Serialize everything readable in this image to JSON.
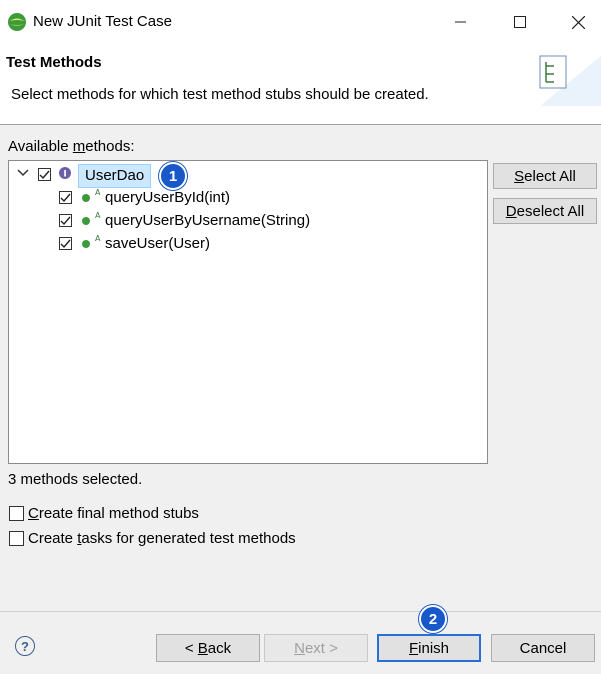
{
  "window": {
    "title": "New JUnit Test Case",
    "controls": [
      "minimize",
      "maximize",
      "close"
    ]
  },
  "header": {
    "title": "Test Methods",
    "description": "Select methods for which test method stubs should be created."
  },
  "available_methods_label": {
    "pre": "Available ",
    "mnemonic": "m",
    "post": "ethods:"
  },
  "tree": {
    "root": {
      "label": "UserDao",
      "checked": true,
      "expanded": true,
      "icon": "interface-icon"
    },
    "children": [
      {
        "label": "queryUserById(int)",
        "checked": true,
        "icon": "abstract-method-icon"
      },
      {
        "label": "queryUserByUsername(String)",
        "checked": true,
        "icon": "abstract-method-icon"
      },
      {
        "label": "saveUser(User)",
        "checked": true,
        "icon": "abstract-method-icon"
      }
    ]
  },
  "side_buttons": {
    "select_all": {
      "mnemonic": "S",
      "rest": "elect All"
    },
    "deselect_all": {
      "mnemonic": "D",
      "rest": "eselect All"
    }
  },
  "status_text": "3 methods selected.",
  "options": {
    "final_stubs": {
      "mnemonic": "C",
      "rest": "reate final method stubs",
      "checked": false
    },
    "tasks": {
      "pre": "Create ",
      "mnemonic": "t",
      "rest": "asks for generated test methods",
      "checked": false
    }
  },
  "badges": {
    "one": "1",
    "two": "2"
  },
  "footer": {
    "help": "?",
    "back": {
      "pre": "< ",
      "mnemonic": "B",
      "rest": "ack"
    },
    "next": {
      "mnemonic": "N",
      "rest": "ext >"
    },
    "finish": {
      "mnemonic": "F",
      "rest": "inish"
    },
    "cancel": "Cancel"
  },
  "colors": {
    "accent": "#1858c8",
    "selection": "#cce8ff",
    "method_dot": "#3c9a3c"
  }
}
